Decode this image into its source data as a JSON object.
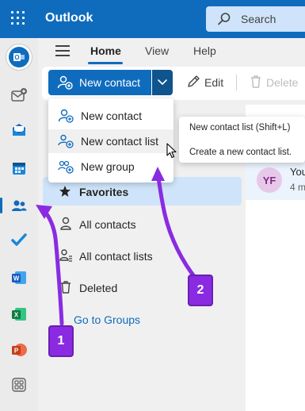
{
  "app": {
    "title": "Outlook"
  },
  "search": {
    "label": "Search"
  },
  "tabs": [
    {
      "label": "Home",
      "active": true
    },
    {
      "label": "View",
      "active": false
    },
    {
      "label": "Help",
      "active": false
    }
  ],
  "ribbon": {
    "new_contact_label": "New contact",
    "edit_label": "Edit",
    "delete_label": "Delete"
  },
  "dropdown": {
    "items": [
      {
        "label": "New contact",
        "icon": "add-person-icon"
      },
      {
        "label": "New contact list",
        "icon": "add-people-icon",
        "hovered": true
      },
      {
        "label": "New group",
        "icon": "add-group-icon"
      }
    ]
  },
  "tooltip": {
    "title": "New contact list (Shift+L)",
    "description": "Create a new contact list."
  },
  "folders": {
    "favorites": "Favorites",
    "items": [
      {
        "label": "All contacts",
        "icon": "person-icon"
      },
      {
        "label": "All contact lists",
        "icon": "people-list-icon"
      },
      {
        "label": "Deleted",
        "icon": "trash-icon"
      }
    ],
    "groups_link": "Go to Groups"
  },
  "contact_peek": {
    "initials": "YF",
    "line1": "You",
    "line2": "4 m"
  },
  "rail": [
    "outlook-icon",
    "new-mail-icon",
    "mail-icon",
    "calendar-icon",
    "people-icon",
    "todo-icon",
    "word-icon",
    "excel-icon",
    "powerpoint-icon",
    "apps-icon"
  ],
  "annotations": {
    "callout_1": "1",
    "callout_2": "2"
  },
  "colors": {
    "brand": "#0f6cbd",
    "selected": "#cfe4fa",
    "annotation": "#8a2be2"
  }
}
